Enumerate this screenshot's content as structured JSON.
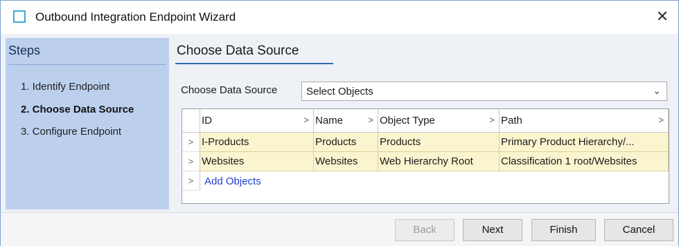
{
  "window": {
    "title": "Outbound Integration Endpoint Wizard",
    "close_glyph": "✕"
  },
  "steps": {
    "header": "Steps",
    "items": [
      {
        "label": "1. Identify Endpoint",
        "active": false
      },
      {
        "label": "2. Choose Data Source",
        "active": true
      },
      {
        "label": "3. Configure Endpoint",
        "active": false
      }
    ]
  },
  "main": {
    "title": "Choose Data Source",
    "data_source_label": "Choose Data Source",
    "data_source_value": "Select Objects"
  },
  "grid": {
    "columns": [
      "ID",
      "Name",
      "Object Type",
      "Path"
    ],
    "rows": [
      [
        "I-Products",
        "Products",
        "Products",
        "Primary Product Hierarchy/..."
      ],
      [
        "Websites",
        "Websites",
        "Web Hierarchy Root",
        "Classification 1 root/Websites"
      ]
    ],
    "add_link": "Add Objects"
  },
  "footer": {
    "back": "Back",
    "next": "Next",
    "finish": "Finish",
    "cancel": "Cancel"
  },
  "colors": {
    "steps_bg": "#bcd0ee",
    "row_highlight": "#fbf5cf",
    "link": "#1f3fcf",
    "accent": "#2f6db3"
  }
}
